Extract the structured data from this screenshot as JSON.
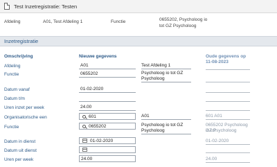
{
  "window": {
    "title": "Test Inzetregistratie: Testen"
  },
  "previous_row": {
    "afdeling_label": "Afdeling",
    "afdeling_value": "A01, Test Afdeling 1",
    "functie_label": "Functie",
    "functie_value_1": "0655202, Psycholoog io",
    "functie_value_2": "tot GZ Psycholoog"
  },
  "section": {
    "title": "Inzetregistratie"
  },
  "headers": {
    "omschrijving": "Omschrijving",
    "nieuwe": "Nieuwe gegevens",
    "oude": "Oude gegevens op 11-08-2023"
  },
  "rows": {
    "afdeling": {
      "label": "Afdeling",
      "value": "A01",
      "mid": "Test Afdeling 1"
    },
    "functie": {
      "label": "Functie",
      "value": "0655202",
      "mid_1": "Psycholoog io tot GZ",
      "mid_2": "Psycholoog"
    },
    "datum_vanaf": {
      "label": "Datum vanaf",
      "value": "01-02-2020"
    },
    "datum_tm": {
      "label": "Datum t/m",
      "value": ""
    },
    "uren": {
      "label": "Uren inzet per week",
      "value": "24.00"
    },
    "org_eenheid": {
      "label": "Organisatorische een",
      "value": "601",
      "mid": "A01",
      "old": "601 A01"
    },
    "functie2": {
      "label": "Functie",
      "value": "0655202",
      "mid_1": "Psycholoog io tot GZ",
      "mid_2": "Psycholoog",
      "old_1": "0655202 Psycholoog io tot",
      "old_2": "GZ Psycholoog"
    },
    "in_dienst": {
      "label": "Datum in dienst",
      "value": "01-02-2020",
      "old": "01-02-2020"
    },
    "uit_dienst": {
      "label": "Datum uit dienst",
      "value": ""
    },
    "uren_week": {
      "label": "Uren per week",
      "value": "24.00",
      "old": "24.00"
    }
  },
  "icons": {
    "document": "document-icon",
    "search": "search-icon",
    "calendar": "calendar-icon"
  }
}
